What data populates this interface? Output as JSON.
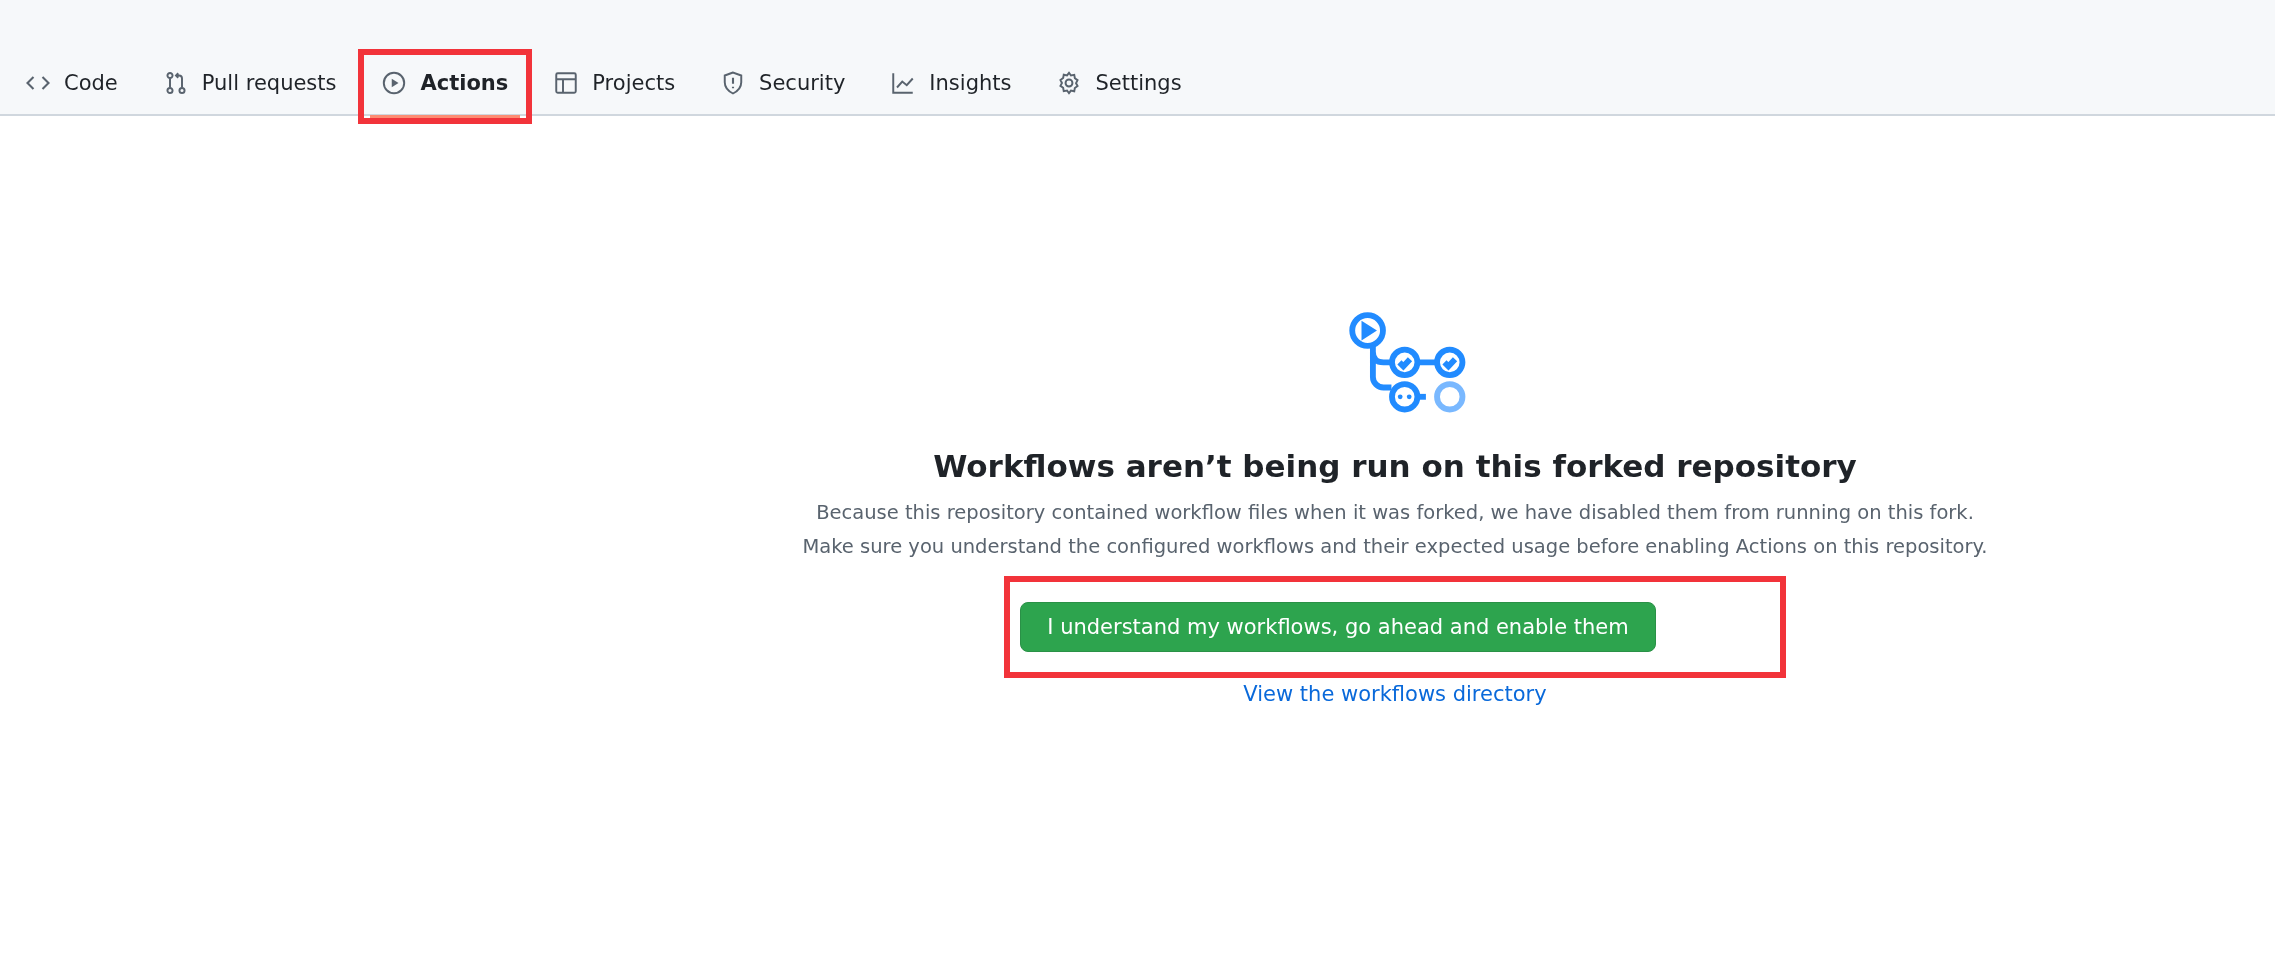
{
  "tabs": [
    {
      "label": "Code",
      "kind": "code",
      "selected": false,
      "highlighted": false
    },
    {
      "label": "Pull requests",
      "kind": "pull",
      "selected": false,
      "highlighted": false
    },
    {
      "label": "Actions",
      "kind": "play",
      "selected": true,
      "highlighted": true
    },
    {
      "label": "Projects",
      "kind": "table",
      "selected": false,
      "highlighted": false
    },
    {
      "label": "Security",
      "kind": "shield",
      "selected": false,
      "highlighted": false
    },
    {
      "label": "Insights",
      "kind": "graph",
      "selected": false,
      "highlighted": false
    },
    {
      "label": "Settings",
      "kind": "gear",
      "selected": false,
      "highlighted": false
    }
  ],
  "blankslate": {
    "title": "Workflows aren’t being run on this forked repository",
    "description": "Because this repository contained workflow files when it was forked, we have disabled them from running on this fork. Make sure you understand the configured workflows and their expected usage before enabling Actions on this repository.",
    "button": {
      "label": "I understand my workflows, go ahead and enable them",
      "highlighted": true
    },
    "link": "View the workflows directory"
  }
}
